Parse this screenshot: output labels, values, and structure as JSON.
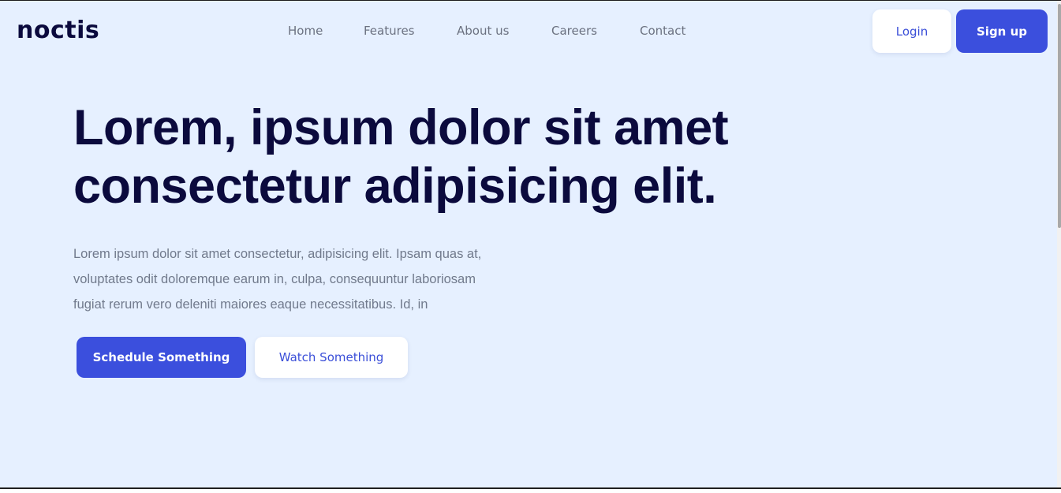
{
  "header": {
    "brand": "noctis",
    "nav": [
      "Home",
      "Features",
      "About us",
      "Careers",
      "Contact"
    ],
    "login_label": "Login",
    "signup_label": "Sign up"
  },
  "hero": {
    "title_line1": "Lorem, ipsum dolor sit amet",
    "title_line2": "consectetur adipisicing elit.",
    "paragraph_line1": "Lorem ipsum dolor sit amet consectetur, adipisicing elit. Ipsam quas at,",
    "paragraph_line2": "voluptates odit doloremque earum in, culpa, consequuntur laboriosam",
    "paragraph_line3": "fugiat rerum vero deleniti maiores eaque necessitatibus. Id, in",
    "primary_button": "Schedule Something",
    "secondary_button": "Watch Something"
  },
  "colors": {
    "background": "#e6f0ff",
    "brand_text": "#0b0a3d",
    "accent": "#3b4fdd",
    "nav_text": "#6b7180",
    "paragraph_text": "#717a8c"
  }
}
